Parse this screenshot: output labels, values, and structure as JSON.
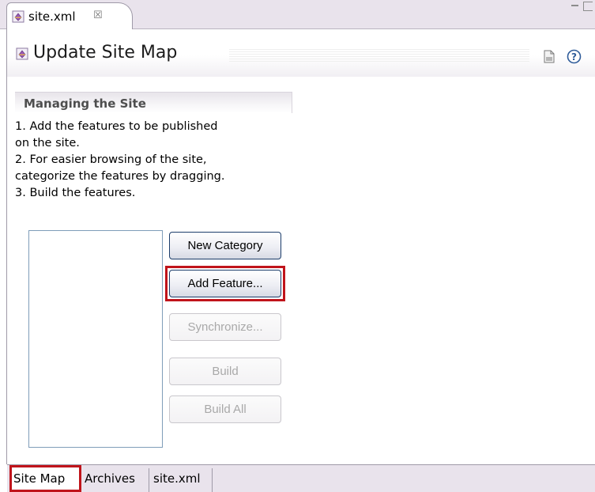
{
  "editor_tab": {
    "title": "site.xml",
    "close_glyph": "☒",
    "icon": "site-file-icon"
  },
  "header": {
    "title": "Update Site Map",
    "icon": "update-site-icon",
    "actions": [
      "binary-build-icon",
      "help-icon"
    ]
  },
  "section": {
    "title": "Managing the Site",
    "lines": [
      "1. Add the features to be published",
      "on the site.",
      "2. For easier browsing of the site,",
      "categorize the features by dragging.",
      "3. Build the features."
    ]
  },
  "buttons": {
    "new_category": "New Category",
    "add_feature": "Add Feature...",
    "synchronize": "Synchronize...",
    "build": "Build",
    "build_all": "Build All"
  },
  "bottom_tabs": [
    "Site Map",
    "Archives",
    "site.xml"
  ],
  "colors": {
    "highlight": "#c0141b",
    "tab_strip": "#e9e3ec"
  }
}
